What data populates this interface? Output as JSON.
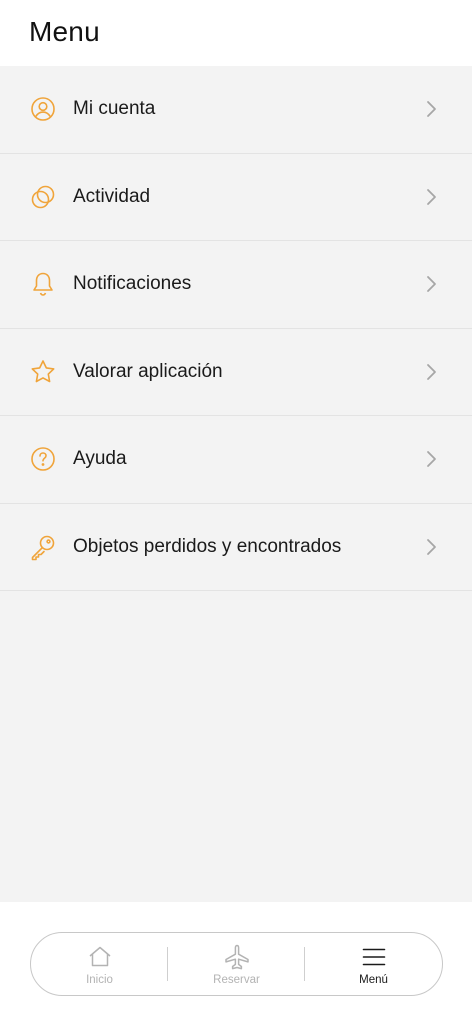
{
  "header": {
    "title": "Menu"
  },
  "theme": {
    "accent": "#f0a43a",
    "chevron": "#a6a6a6",
    "inactive": "#b3b3b3",
    "active": "#1a1a1a"
  },
  "menu": {
    "items": [
      {
        "label": "Mi cuenta",
        "icon": "user-circle-icon"
      },
      {
        "label": "Actividad",
        "icon": "overlapping-circles-icon"
      },
      {
        "label": "Notificaciones",
        "icon": "bell-icon"
      },
      {
        "label": "Valorar aplicación",
        "icon": "star-icon"
      },
      {
        "label": "Ayuda",
        "icon": "question-circle-icon"
      },
      {
        "label": "Objetos perdidos y encontrados",
        "icon": "key-icon"
      }
    ]
  },
  "tabbar": {
    "tabs": [
      {
        "label": "Inicio",
        "icon": "home-icon",
        "active": false
      },
      {
        "label": "Reservar",
        "icon": "plane-icon",
        "active": false
      },
      {
        "label": "Menú",
        "icon": "hamburger-menu-icon",
        "active": true
      }
    ]
  }
}
